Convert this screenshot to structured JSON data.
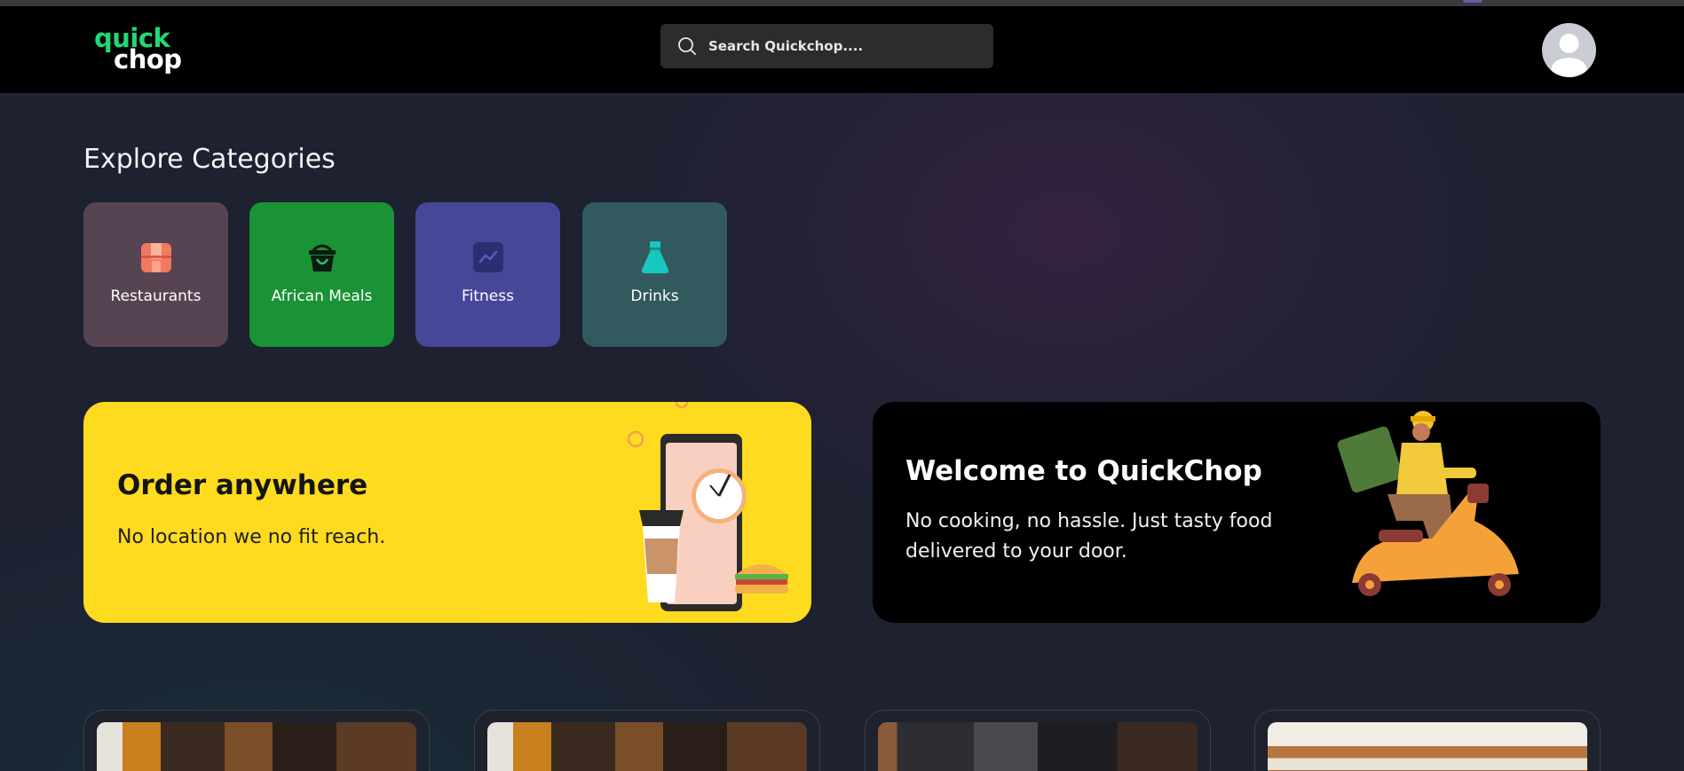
{
  "header": {
    "logo_line1": "quick",
    "logo_line2": "chop",
    "search_placeholder": "Search Quickchop...."
  },
  "categories_title": "Explore Categories",
  "categories": [
    {
      "label": "Restaurants",
      "color": "#564453",
      "icon": "store-icon"
    },
    {
      "label": "African Meals",
      "color": "#1a9236",
      "icon": "basket-icon"
    },
    {
      "label": "Fitness",
      "color": "#47479a",
      "icon": "chart-icon"
    },
    {
      "label": "Drinks",
      "color": "#325a5e",
      "icon": "flask-icon"
    }
  ],
  "banners": {
    "order": {
      "title": "Order anywhere",
      "text": "No location we no fit reach.",
      "color": "#ffdb1f"
    },
    "welcome": {
      "title": "Welcome to QuickChop",
      "text": "No cooking, no hassle. Just tasty food delivered to your door.",
      "color": "#000000"
    }
  },
  "colors": {
    "brand_green": "#20d876",
    "background": "#1d2130"
  }
}
